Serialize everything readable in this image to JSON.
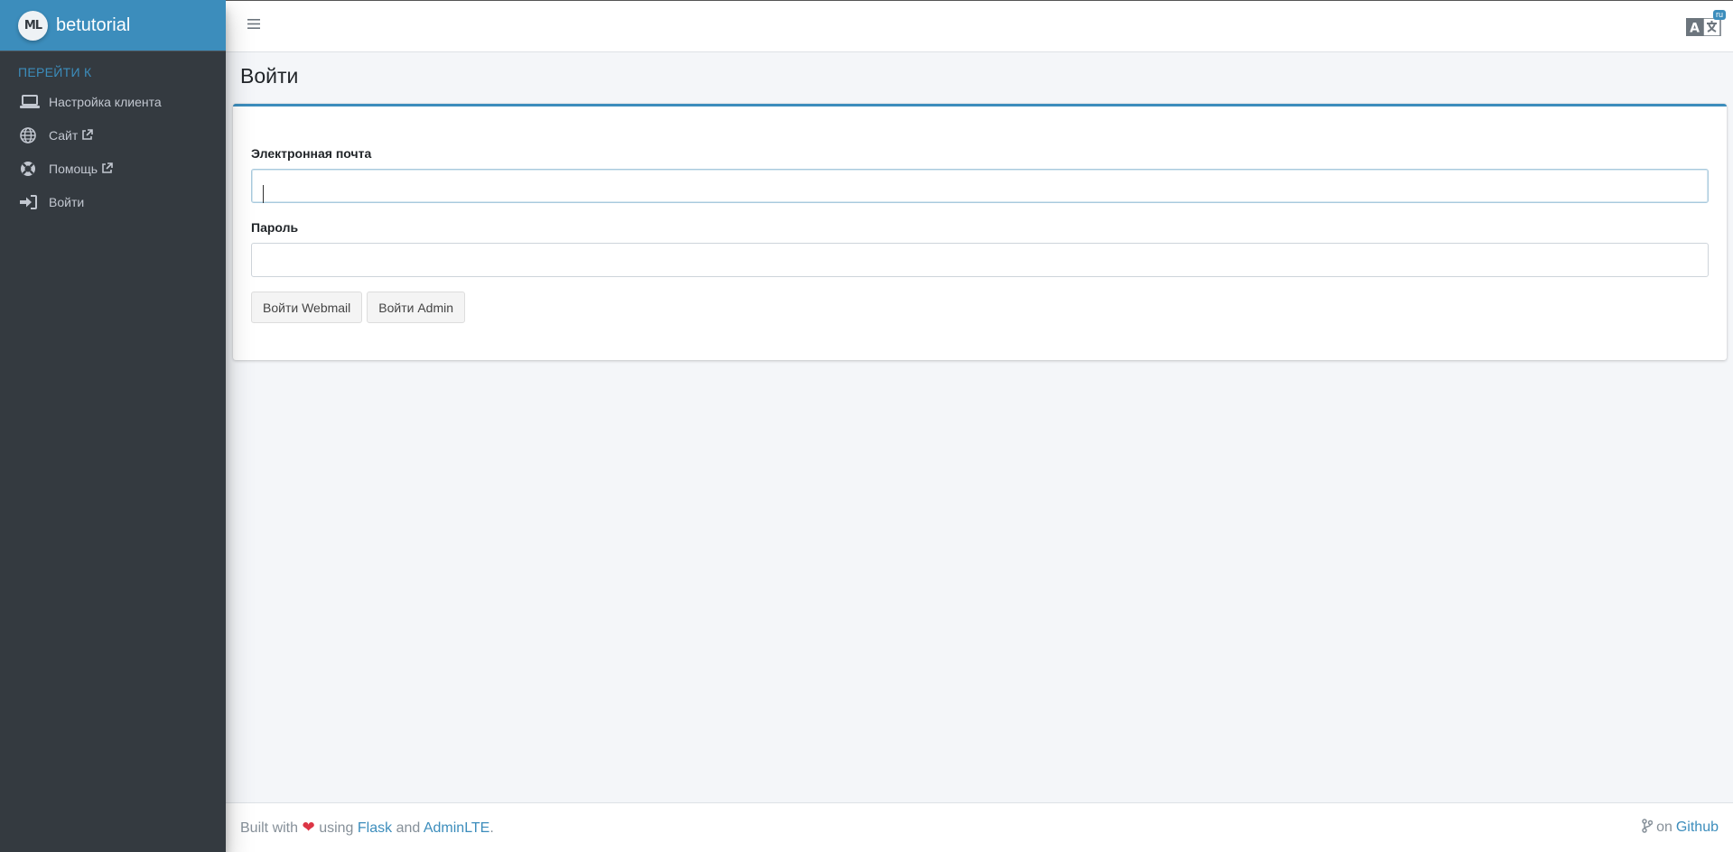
{
  "brand": {
    "name": "betutorial",
    "logo_text": "ML"
  },
  "sidebar": {
    "header": "ПЕРЕЙТИ К",
    "items": [
      {
        "label": "Настройка клиента",
        "icon": "laptop-icon"
      },
      {
        "label": "Сайт",
        "icon": "globe-icon",
        "external": true
      },
      {
        "label": "Помощь",
        "icon": "life-ring-icon",
        "external": true
      },
      {
        "label": "Войти",
        "icon": "sign-in-icon"
      }
    ]
  },
  "navbar": {
    "language_badge": "ru",
    "language_icon": "language-icon"
  },
  "page": {
    "title": "Войти"
  },
  "form": {
    "email_label": "Электронная почта",
    "email_value": "",
    "password_label": "Пароль",
    "password_value": "",
    "webmail_button": "Войти Webmail",
    "admin_button": "Войти Admin"
  },
  "footer": {
    "built_with": "Built with",
    "using": "using",
    "flask": "Flask",
    "and": "and",
    "adminlte": "AdminLTE",
    "period": ".",
    "on": "on",
    "github": "Github"
  },
  "colors": {
    "accent": "#3c8dbc",
    "sidebar_bg": "#343a40",
    "heart": "#dc3545"
  }
}
